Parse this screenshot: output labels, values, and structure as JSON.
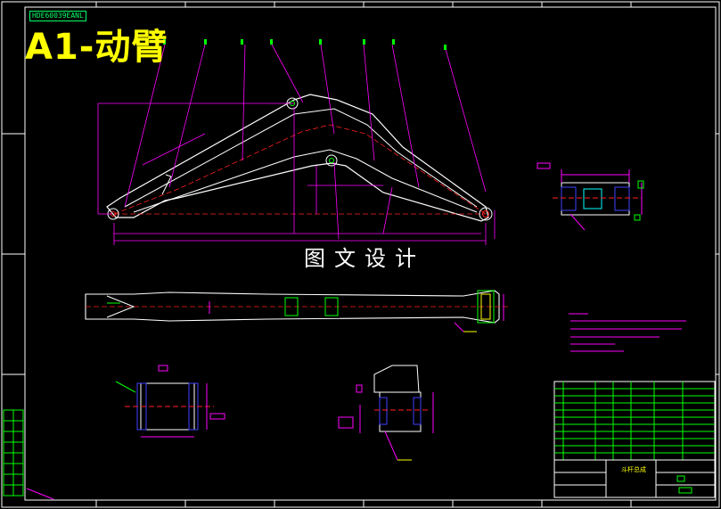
{
  "drawing": {
    "title": "A1-动臂",
    "stamp_code": "HDE60039EANL",
    "watermark": "图文设计",
    "title_block_name": "斗杆总成"
  },
  "colors": {
    "background": "#000000",
    "frame": "#ffffff",
    "centerline": "#ff2020",
    "dimension": "#ff00ff",
    "leader": "#ff00ff",
    "title_text": "#ffff00",
    "label_green": "#00ff00",
    "detail_blue": "#4040ff",
    "detail_cyan": "#00ffff"
  }
}
